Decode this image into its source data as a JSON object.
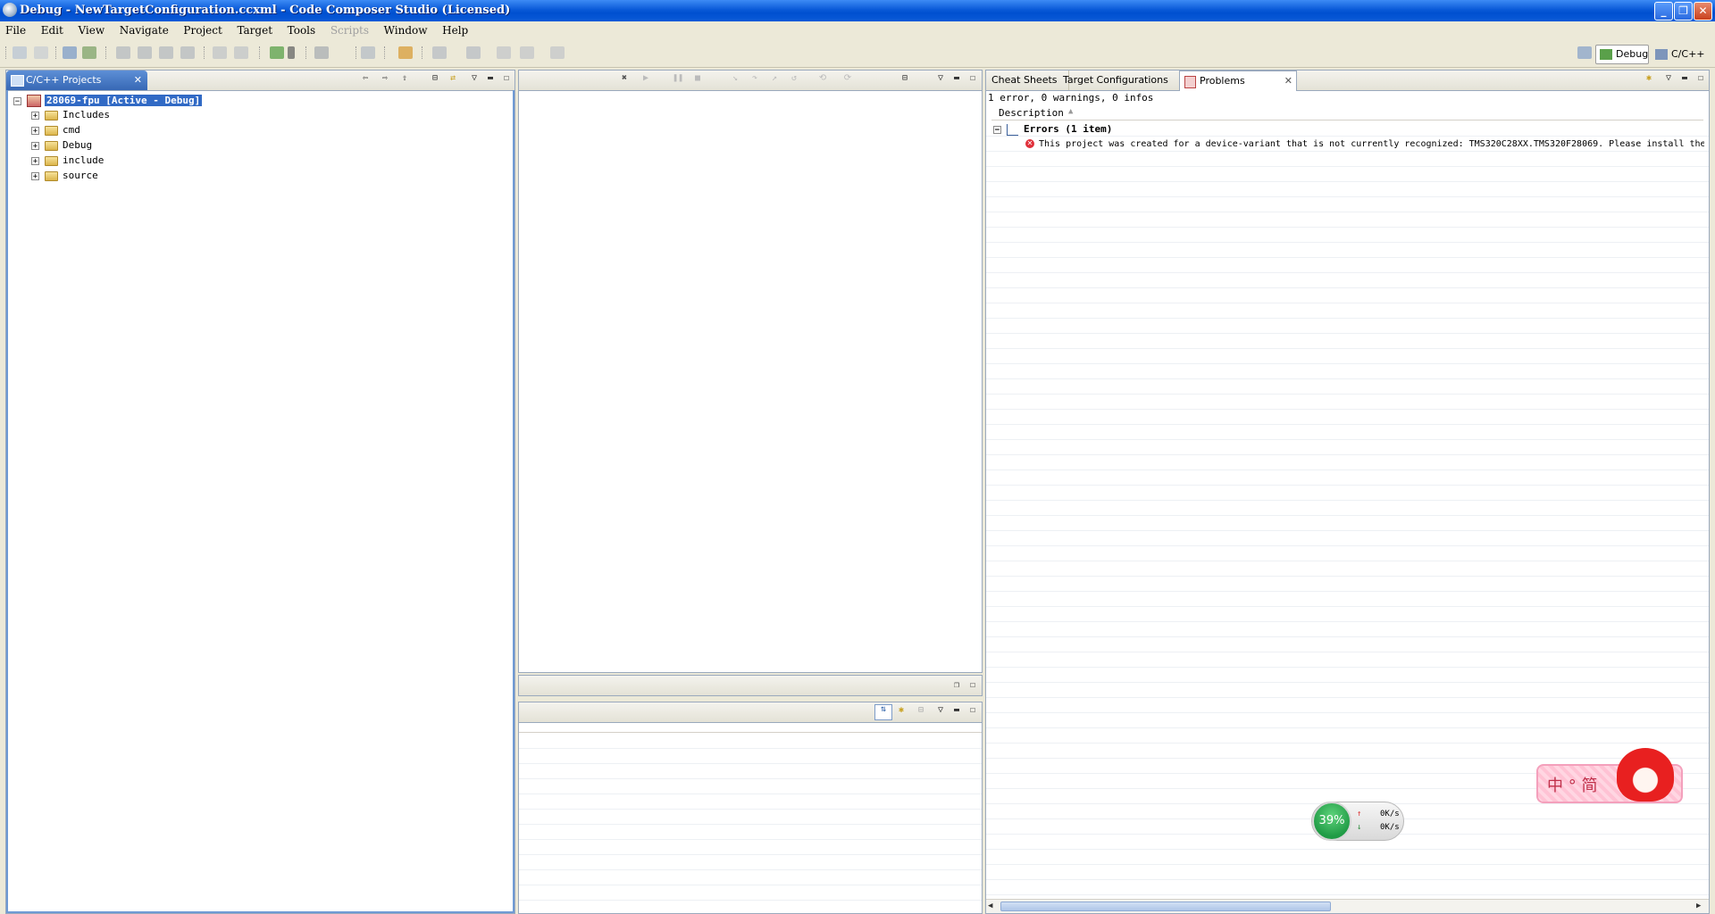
{
  "window": {
    "title": "Debug - NewTargetConfiguration.ccxml - Code Composer Studio (Licensed)"
  },
  "menu": [
    "File",
    "Edit",
    "View",
    "Navigate",
    "Project",
    "Target",
    "Tools",
    "Scripts",
    "Window",
    "Help"
  ],
  "perspectives": {
    "debug": "Debug",
    "cpp": "C/C++"
  },
  "projects_view": {
    "tab": "C/C++ Projects",
    "project": "28069-fpu  [Active - Debug]",
    "items": [
      "Includes",
      "cmd",
      "Debug",
      "include",
      "source"
    ]
  },
  "right_tabs": {
    "cheat": "Cheat Sheets",
    "target": "Target Configurations",
    "problems": "Problems"
  },
  "problems": {
    "summary": "1 error, 0 warnings, 0 infos",
    "column": "Description",
    "group": "Errors (1 item)",
    "message": "This project was created for a device-variant that is not currently recognized: TMS320C28XX.TMS320F28069. Please install the"
  },
  "tray": {
    "percent": "39%",
    "up": "0K/s",
    "down": "0K/s",
    "ime": "中 ° 简"
  },
  "colors": {
    "titlebar": "#0a5ad8",
    "selection": "#316ac5",
    "error": "#e0303a"
  }
}
